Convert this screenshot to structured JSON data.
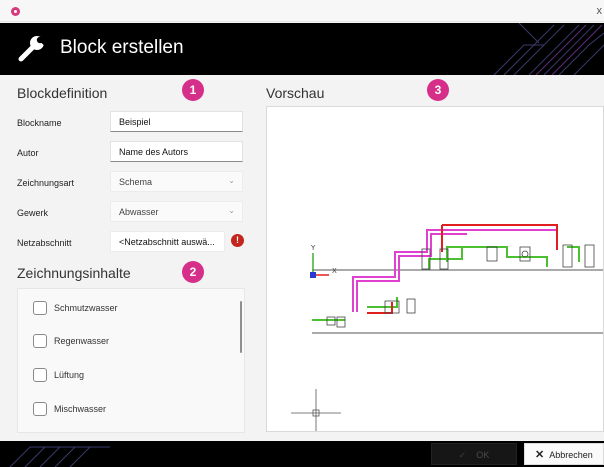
{
  "window": {
    "close_glyph": "x"
  },
  "header": {
    "title": "Block erstellen",
    "icon": "wrench-icon"
  },
  "blockdefinition": {
    "title": "Blockdefinition",
    "badge": "1",
    "fields": {
      "blockname": {
        "label": "Blockname",
        "value": "Beispiel"
      },
      "autor": {
        "label": "Autor",
        "value": "Name des Autors"
      },
      "zeichnungsart": {
        "label": "Zeichnungsart",
        "value": "Schema"
      },
      "gewerk": {
        "label": "Gewerk",
        "value": "Abwasser"
      },
      "netzabschnitt": {
        "label": "Netzabschnitt",
        "value": "<Netzabschnitt auswä...",
        "error": "!"
      }
    }
  },
  "zeichnungsinhalte": {
    "title": "Zeichnungsinhalte",
    "badge": "2",
    "items": [
      {
        "label": "Schmutzwasser",
        "checked": false
      },
      {
        "label": "Regenwasser",
        "checked": false
      },
      {
        "label": "Lüftung",
        "checked": false
      },
      {
        "label": "Mischwasser",
        "checked": false
      }
    ]
  },
  "vorschau": {
    "title": "Vorschau",
    "badge": "3",
    "axes": {
      "y": "Y",
      "x": "X"
    }
  },
  "footer": {
    "ok_label": "OK",
    "cancel_label": "Abbrechen"
  },
  "colors": {
    "accent": "#d62f89",
    "error": "#c4261d",
    "pipe_magenta": "#e040d0",
    "pipe_red": "#e02020",
    "pipe_green": "#4cc030",
    "axis_blue": "#2a3ad0"
  }
}
